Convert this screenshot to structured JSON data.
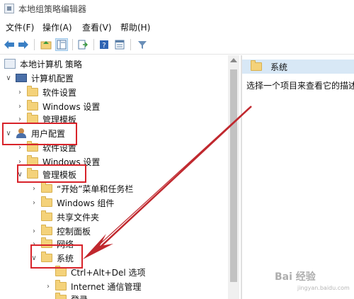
{
  "window": {
    "title": "本地组策略编辑器"
  },
  "menu": [
    "文件(F)",
    "操作(A)",
    "查看(V)",
    "帮助(H)"
  ],
  "toolbar": {
    "icons": [
      "back-arrow-icon",
      "forward-arrow-icon",
      "up-folder-icon",
      "show-hide-tree-icon",
      "export-list-icon",
      "help-icon",
      "properties-icon",
      "filter-icon"
    ]
  },
  "tree": {
    "root": "本地计算机 策略",
    "computer_config": "计算机配置",
    "cc_software": "软件设置",
    "cc_windows": "Windows 设置",
    "cc_admin": "管理模板",
    "user_config": "用户配置",
    "uc_software": "软件设置",
    "uc_windows": "Windows 设置",
    "uc_admin": "管理模板",
    "start_taskbar": "“开始”菜单和任务栏",
    "win_components": "Windows 组件",
    "shared_folders": "共享文件夹",
    "control_panel": "控制面板",
    "network": "网络",
    "system": "系统",
    "ctrl_alt_del": "Ctrl+Alt+Del 选项",
    "internet_comm": "Internet 通信管理",
    "logon": "登录"
  },
  "right_pane": {
    "header": "系统",
    "message": "选择一个项目来查看它的描述"
  },
  "watermark": {
    "brand": "Bai 经验",
    "url": "jingyan.baidu.com"
  },
  "colors": {
    "highlight_box": "#d8232a",
    "arrow": "#c0282e",
    "header_bg": "#d8e8f6",
    "folder": "#f4d27a"
  }
}
